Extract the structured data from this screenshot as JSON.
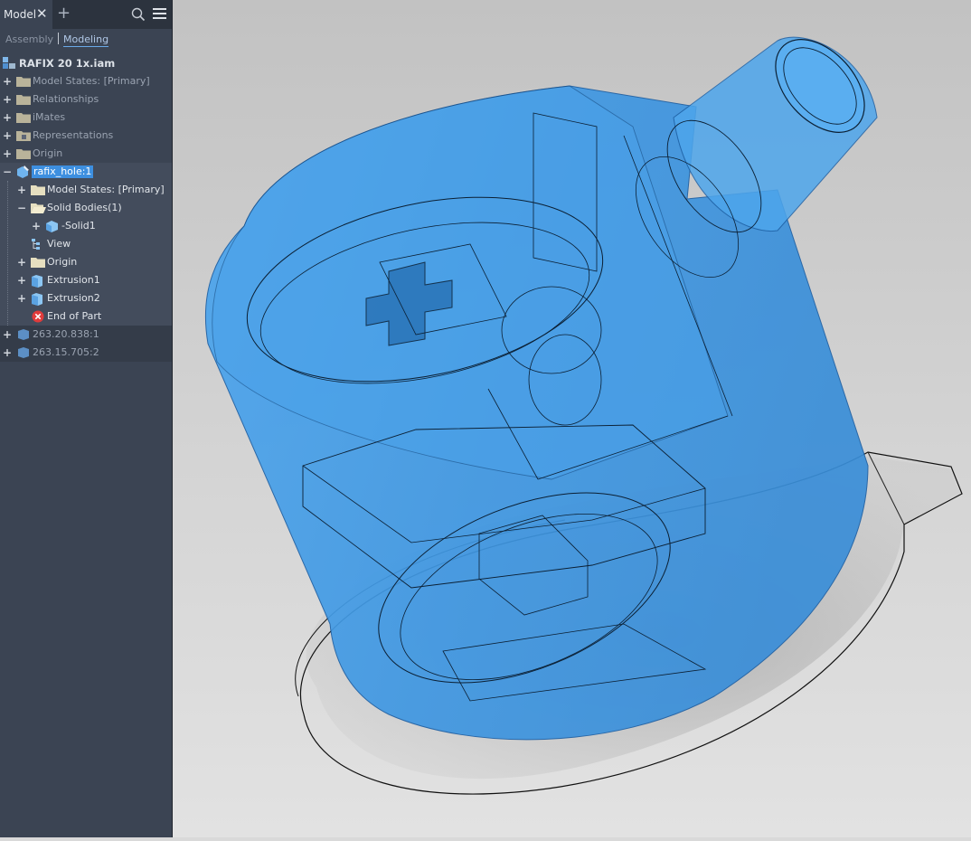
{
  "browser": {
    "tab_label": "Model",
    "subtabs": [
      "Assembly",
      "Modeling"
    ],
    "active_subtab": "Modeling",
    "tree": {
      "root": "RAFIX 20 1x.iam",
      "assembly_items": [
        "Model States: [Primary]",
        "Relationships",
        "iMates",
        "Representations",
        "Origin"
      ],
      "active_part": "rafix_hole:1",
      "part_items": {
        "model_states": "Model States: [Primary]",
        "solid_bodies": "Solid Bodies(1)",
        "solid1": "-Solid1",
        "view": "View",
        "origin": "Origin",
        "extrusion1": "Extrusion1",
        "extrusion2": "Extrusion2",
        "end_of_part": "End of Part"
      },
      "other_components": [
        "263.20.838:1",
        "263.15.705:2"
      ]
    }
  },
  "colors": {
    "model_fill": "#3f9ae3",
    "panel_bg": "#3b4453",
    "selection": "#3d8fe0",
    "arrow": "#e41b1b"
  }
}
